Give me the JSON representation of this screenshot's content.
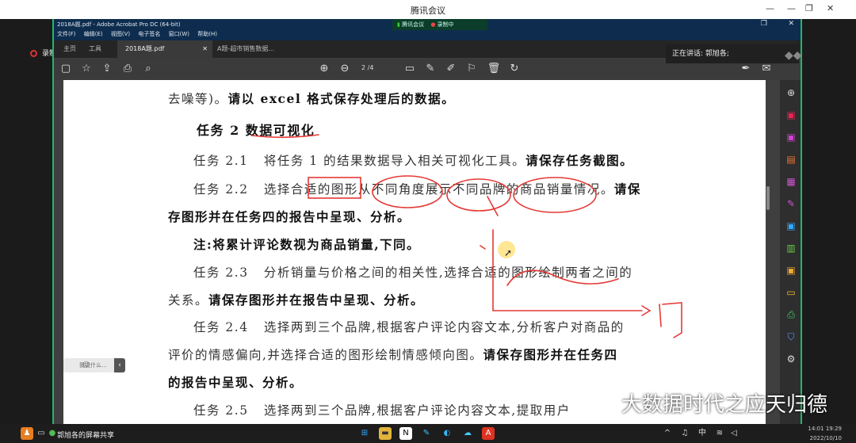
{
  "outer_window": {
    "title": "腾讯会议",
    "min": "—",
    "restore": "❐",
    "close": "✕"
  },
  "recording": {
    "label": "录制中"
  },
  "speaking": {
    "label": "正在讲话: 郭旭各;"
  },
  "acrobat": {
    "title": "2018A题.pdf - Adobe Acrobat Pro DC (64-bit)",
    "meeting_label": "腾讯会议",
    "meeting_rec": "录制中",
    "menu": [
      "文件(F)",
      "编辑(E)",
      "视图(V)",
      "电子签名",
      "窗口(W)",
      "帮助(H)"
    ],
    "tabs": {
      "home": "主页",
      "tools": "工具",
      "doc1": "2018A题.pdf",
      "doc2": "A题-超市销售数据..."
    },
    "page_indicator": "2  /4"
  },
  "document": {
    "line1_a": "去噪等)。",
    "line1_b": "请以 excel 格式保存处理后的数据。",
    "heading": "任务 2   数据可视化",
    "t21_label": "任务 2.1",
    "t21_a": "将任务 1 的结果数据导入相关可视化工具。",
    "t21_b": "请保存任务截图。",
    "t22_label": "任务 2.2",
    "t22_a": "选择合适的图形从不同角度展示不同品牌的商品销量情况。",
    "t22_b": "请保",
    "t22_c": "存图形并在任务四的报告中呈现、分析。",
    "note": "注:将累计评论数视为商品销量,下同。",
    "t23_label": "任务 2.3",
    "t23_a": "分析销量与价格之间的相关性,选择合适的图形绘制两者之间的",
    "t23_b": "关系。",
    "t23_c": "请保存图形并在报告中呈现、分析。",
    "t24_label": "任务 2.4",
    "t24_a": "选择两到三个品牌,根据客户评论内容文本,分析客户对商品的",
    "t24_b": "评价的情感偏向,并选择合适的图形绘制情感倾向图。",
    "t24_c": "请保存图形并在任务四",
    "t24_d": "的报告中呈现、分析。",
    "t25_label": "任务 2.5",
    "t25_a": "选择两到三个品牌,根据客户评论内容文本,提取用户"
  },
  "comment_pill": {
    "label": "我说什么..."
  },
  "watermark": {
    "text": "大数据时代之应天归德"
  },
  "taskbar": {
    "share_label": "郭旭各的屏幕共享",
    "time": "14:01",
    "time_small": "19:29",
    "date": "2022/10/10",
    "ime": "中"
  }
}
